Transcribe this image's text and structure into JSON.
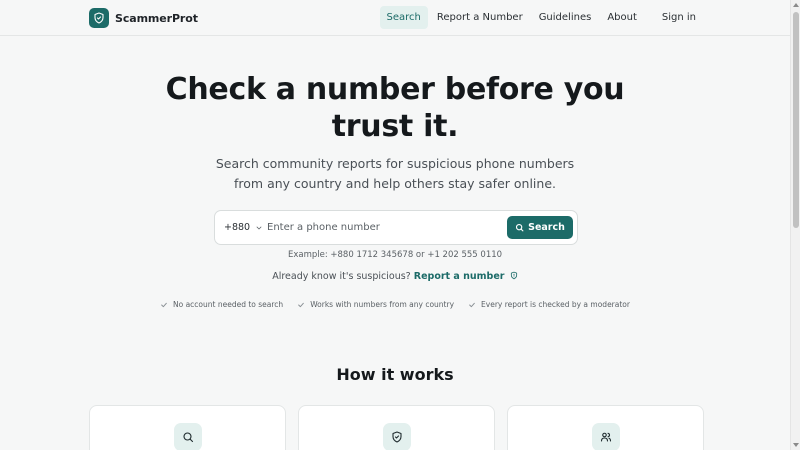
{
  "header": {
    "brand": "ScammerProt",
    "nav": [
      "Search",
      "Report a Number",
      "Guidelines",
      "About"
    ],
    "sign_in": "Sign in"
  },
  "hero": {
    "title_line1": "Check a number before you",
    "title_line2": "trust it.",
    "subtitle_line1": "Search community reports for suspicious phone numbers",
    "subtitle_line2": "from any country and help others stay safer online."
  },
  "search": {
    "country_code": "+880",
    "placeholder": "Enter a phone number",
    "button_label": "Search",
    "example": "Example: +880 1712 345678 or +1 202 555 0110"
  },
  "report_prompt": {
    "text": "Already know it's suspicious?",
    "link": "Report a number"
  },
  "features": [
    "No account needed to search",
    "Works with numbers from any country",
    "Every report is checked by a moderator"
  ],
  "how_it_works": {
    "title": "How it works",
    "cards": [
      {
        "icon": "search-icon"
      },
      {
        "icon": "shield-icon"
      },
      {
        "icon": "users-icon"
      }
    ]
  },
  "colors": {
    "accent": "#1c6b68",
    "accent_light": "#e3f0ee",
    "background": "#f6f7f7"
  }
}
